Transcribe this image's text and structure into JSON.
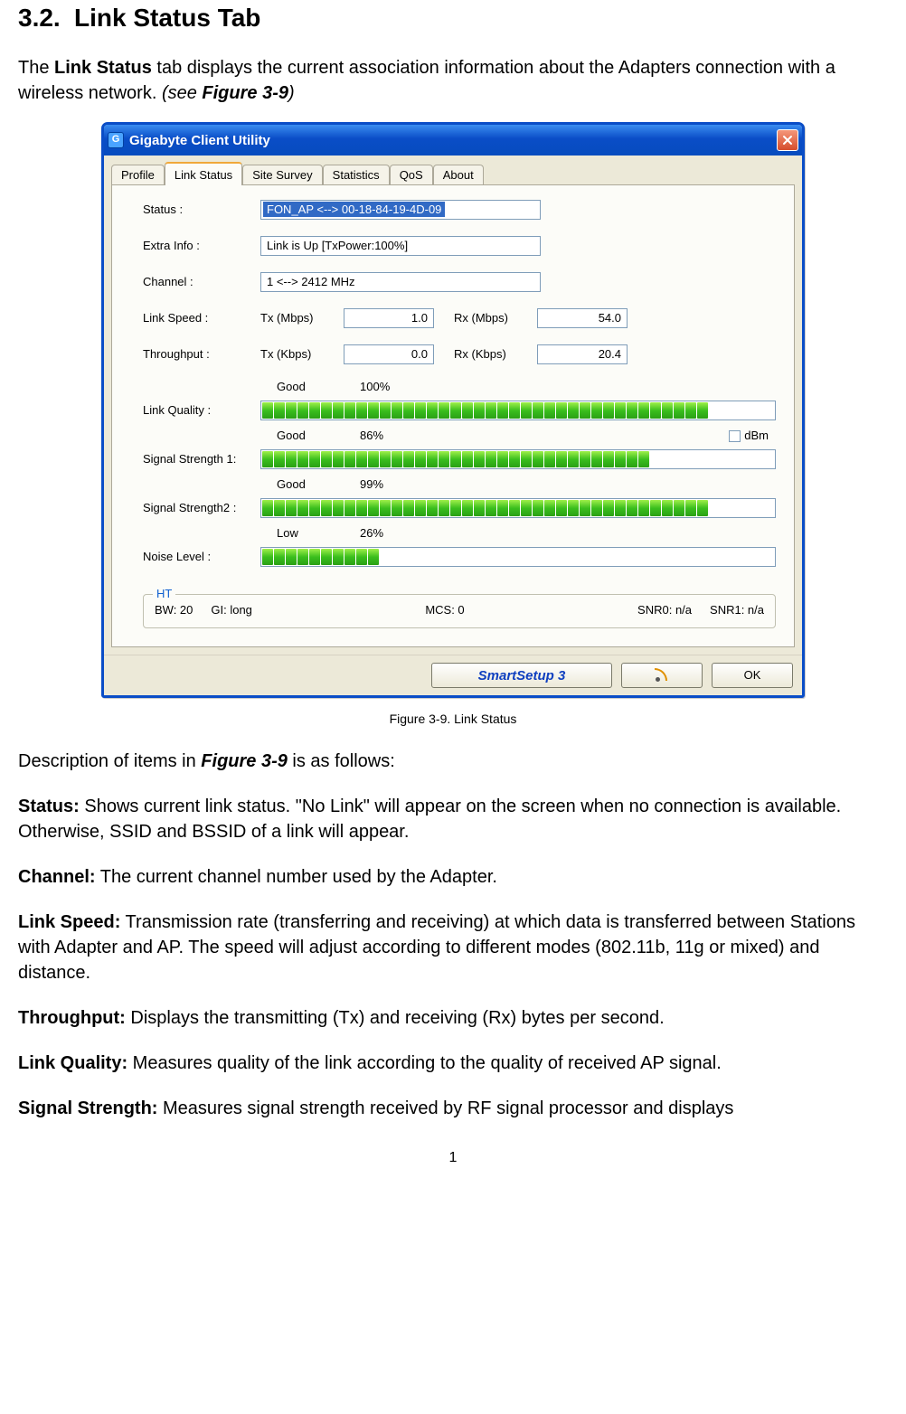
{
  "heading": {
    "number": "3.2.",
    "title": "Link Status Tab"
  },
  "intro": {
    "prefix": "The ",
    "bold": "Link Status",
    "middle": " tab displays the current association information about the Adapters connection with a wireless network. ",
    "italic_open": "(see ",
    "italic_bold": "Figure 3-9",
    "italic_close": ")"
  },
  "window": {
    "title": "Gigabyte Client Utility",
    "icon_letter": "G",
    "tabs": [
      "Profile",
      "Link Status",
      "Site Survey",
      "Statistics",
      "QoS",
      "About"
    ],
    "active_tab_index": 1,
    "fields": {
      "status_label": "Status :",
      "status_value": "FON_AP <--> 00-18-84-19-4D-09",
      "extra_label": "Extra Info :",
      "extra_value": "Link is Up [TxPower:100%]",
      "channel_label": "Channel :",
      "channel_value": "1 <--> 2412 MHz",
      "linkspeed_label": "Link Speed :",
      "tx_mbps_label": "Tx (Mbps)",
      "tx_mbps_value": "1.0",
      "rx_mbps_label": "Rx (Mbps)",
      "rx_mbps_value": "54.0",
      "throughput_label": "Throughput :",
      "tx_kbps_label": "Tx (Kbps)",
      "tx_kbps_value": "0.0",
      "rx_kbps_label": "Rx (Kbps)",
      "rx_kbps_value": "20.4",
      "linkquality_label": "Link Quality :",
      "lq_word": "Good",
      "lq_pct": "100%",
      "sig1_label": "Signal Strength 1:",
      "s1_word": "Good",
      "s1_pct": "86%",
      "dbm_label": "dBm",
      "sig2_label": "Signal Strength2 :",
      "s2_word": "Good",
      "s2_pct": "99%",
      "noise_label": "Noise Level :",
      "n_word": "Low",
      "n_pct": "26%"
    },
    "bars": {
      "link_quality_segments": 38,
      "signal1_segments": 33,
      "signal2_segments": 38,
      "noise_segments": 10
    },
    "ht": {
      "legend": "HT",
      "bw": "BW: 20",
      "gi": "GI: long",
      "mcs": "MCS: 0",
      "snr0": "SNR0: n/a",
      "snr1": "SNR1: n/a"
    },
    "buttons": {
      "smart": "SmartSetup 3",
      "ok": "OK"
    }
  },
  "figure_caption": "Figure 3-9.    Link Status",
  "desc_intro": {
    "prefix": "Description of items in ",
    "bold_italic": "Figure 3-9",
    "suffix": " is as follows:"
  },
  "descriptions": [
    {
      "term": "Status:",
      "text": " Shows current link status. \"No Link\" will appear on the screen when no connection is available. Otherwise, SSID and BSSID of a link will appear."
    },
    {
      "term": "Channel:",
      "text": " The current channel number used by the Adapter."
    },
    {
      "term": "Link Speed:",
      "text": " Transmission rate (transferring and receiving) at which data is transferred between Stations with Adapter and AP. The speed will adjust according to different modes (802.11b, 11g or mixed) and distance."
    },
    {
      "term": "Throughput:",
      "text": " Displays the transmitting (Tx) and receiving (Rx) bytes per second."
    },
    {
      "term": "Link Quality:",
      "text": " Measures quality of the link according to the quality of received AP signal."
    },
    {
      "term": "Signal Strength:",
      "text": " Measures signal strength received by RF signal processor and displays"
    }
  ],
  "page_number": "1"
}
